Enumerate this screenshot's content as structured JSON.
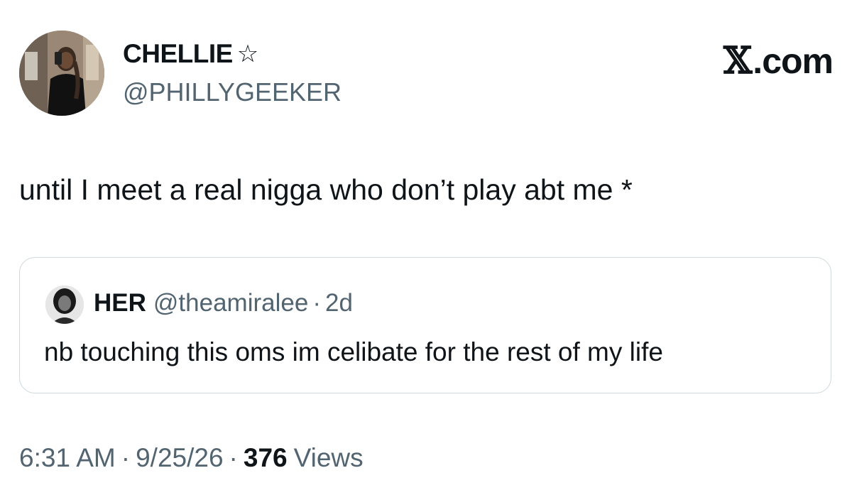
{
  "tweet": {
    "author": {
      "display_name": "CHELLIE",
      "badge_icon": "star-outline-icon",
      "handle": "@PHILLYGEEKER"
    },
    "brand": {
      "x_glyph": "𝕏",
      "suffix": ".com"
    },
    "text": "until I meet a real nigga who don’t play abt me *",
    "quoted_tweet": {
      "display_name": "HER",
      "handle": "@theamiralee",
      "separator": "·",
      "time": "2d",
      "text": "nb touching this oms im celibate for the rest of my life"
    },
    "meta": {
      "time": "6:31 AM",
      "separator": "·",
      "date": "9/25/26",
      "views_count": "376",
      "views_label": "Views"
    }
  },
  "colors": {
    "text_primary": "#0f1419",
    "text_secondary": "#536471",
    "border": "#cfd9de",
    "background": "#ffffff"
  }
}
